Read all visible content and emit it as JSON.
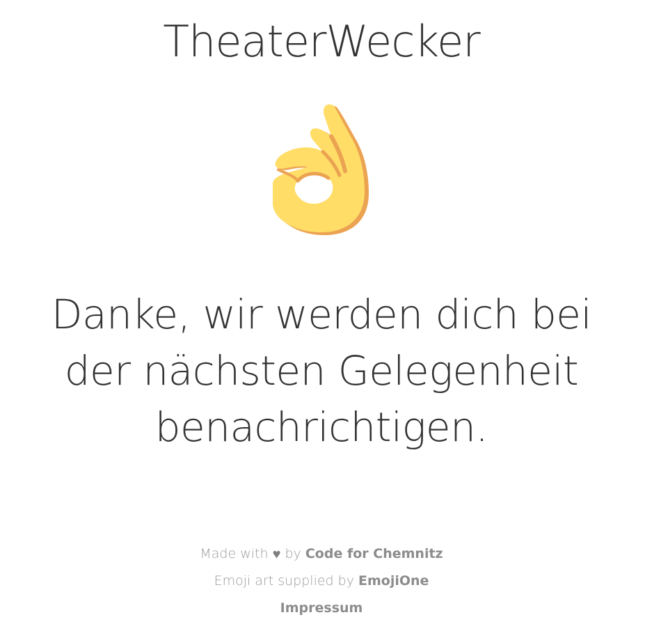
{
  "header": {
    "title": "TheaterWecker"
  },
  "emoji": {
    "name": "ok-hand-icon"
  },
  "main": {
    "message_line_1": "Danke, wir werden dich bei",
    "message_line_2": "der nächsten Gelegenheit",
    "message_line_3": "benachrichtigen."
  },
  "footer": {
    "made_with_prefix": "Made with",
    "heart_glyph": "♥",
    "made_with_by": "by",
    "org_link": "Code for Chemnitz",
    "emoji_prefix": "Emoji art supplied by",
    "emoji_link": "EmojiOne",
    "impressum_link": "Impressum"
  },
  "colors": {
    "text": "#333333",
    "footer_text": "#9a9a9a",
    "emoji_fill": "#FFDD67",
    "emoji_shade": "#EBA352"
  }
}
